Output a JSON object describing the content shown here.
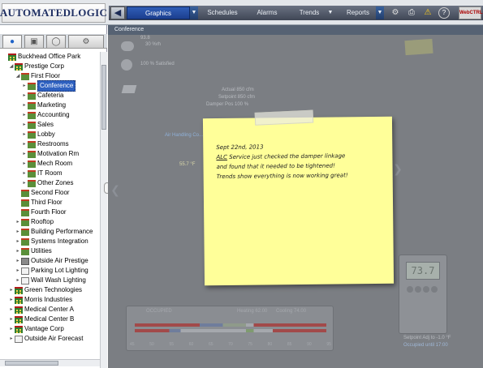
{
  "app": {
    "logo": "AUTOMATEDLOGIC",
    "brand": "WebCTRL",
    "colors": {
      "nav_active": "#1c3f8f",
      "selection": "#2f61c0",
      "sticky": "#ffff99",
      "graphic_bg": "#7b7e83"
    }
  },
  "nav": {
    "back_icon": "back-arrow-icon",
    "tabs": [
      {
        "label": "Graphics",
        "active": true
      },
      {
        "label": "Schedules",
        "active": false
      },
      {
        "label": "Alarms",
        "active": false
      },
      {
        "label": "Trends",
        "active": false
      },
      {
        "label": "Reports",
        "active": false
      }
    ],
    "tools": [
      "network-icon",
      "print-icon",
      "alarm-warning-icon",
      "help-icon"
    ]
  },
  "tree_tabs": [
    "geographic-icon",
    "network-tree-icon",
    "groups-icon",
    "config-icon"
  ],
  "tree": {
    "items": [
      {
        "label": "Buckhead Office Park"
      },
      {
        "label": "Prestige Corp"
      },
      {
        "label": "First Floor"
      },
      {
        "label": "Conference"
      },
      {
        "label": "Cafeteria"
      },
      {
        "label": "Marketing"
      },
      {
        "label": "Accounting"
      },
      {
        "label": "Sales"
      },
      {
        "label": "Lobby"
      },
      {
        "label": "Restrooms"
      },
      {
        "label": "Motivation Rm"
      },
      {
        "label": "Mech Room"
      },
      {
        "label": "IT Room"
      },
      {
        "label": "Other Zones"
      },
      {
        "label": "Second Floor"
      },
      {
        "label": "Third Floor"
      },
      {
        "label": "Fourth Floor"
      },
      {
        "label": "Rooftop"
      },
      {
        "label": "Building Performance"
      },
      {
        "label": "Systems Integration"
      },
      {
        "label": "Utilities"
      },
      {
        "label": "Outside Air Prestige"
      },
      {
        "label": "Parking Lot Lighting"
      },
      {
        "label": "Wall Wash Lighting"
      },
      {
        "label": "Green Technologies"
      },
      {
        "label": "Morris Industries"
      },
      {
        "label": "Medical Center A"
      },
      {
        "label": "Medical Center B"
      },
      {
        "label": "Vantage Corp"
      },
      {
        "label": "Outside Air Forecast"
      }
    ]
  },
  "main": {
    "breadcrumb": "Conference",
    "weather": {
      "temp": "93.8",
      "humidity": "30 %rh",
      "sat": "100 % Satisfied"
    },
    "damper": {
      "actual": "Actual 850 cfm",
      "setpoint": "Setpoint 850 cfm",
      "position": "Damper Pos 100 %"
    },
    "air_handling": "Air Handling Co...",
    "zone_temp": "55.7 °F",
    "thermostat_display": "73.7",
    "setpoint_adj": "Setpoint Adj to -1.0 °F",
    "occupied_until": "Occupied until 17:00",
    "schedule": {
      "status": "OCCUPIED",
      "heating": "Heating 62.00",
      "cooling": "Cooling 74.00",
      "ticks": [
        "45",
        "50",
        "55",
        "60",
        "65",
        "70",
        "75",
        "80",
        "85",
        "90",
        "95"
      ]
    },
    "sticky": {
      "line1": "Sept 22nd, 2013",
      "line2_ul": "ALC",
      "line2": " Service just checked the damper linkage",
      "line3": "and found that it needed to be tightened!",
      "line4": "Trends show everything is now working great!"
    }
  }
}
